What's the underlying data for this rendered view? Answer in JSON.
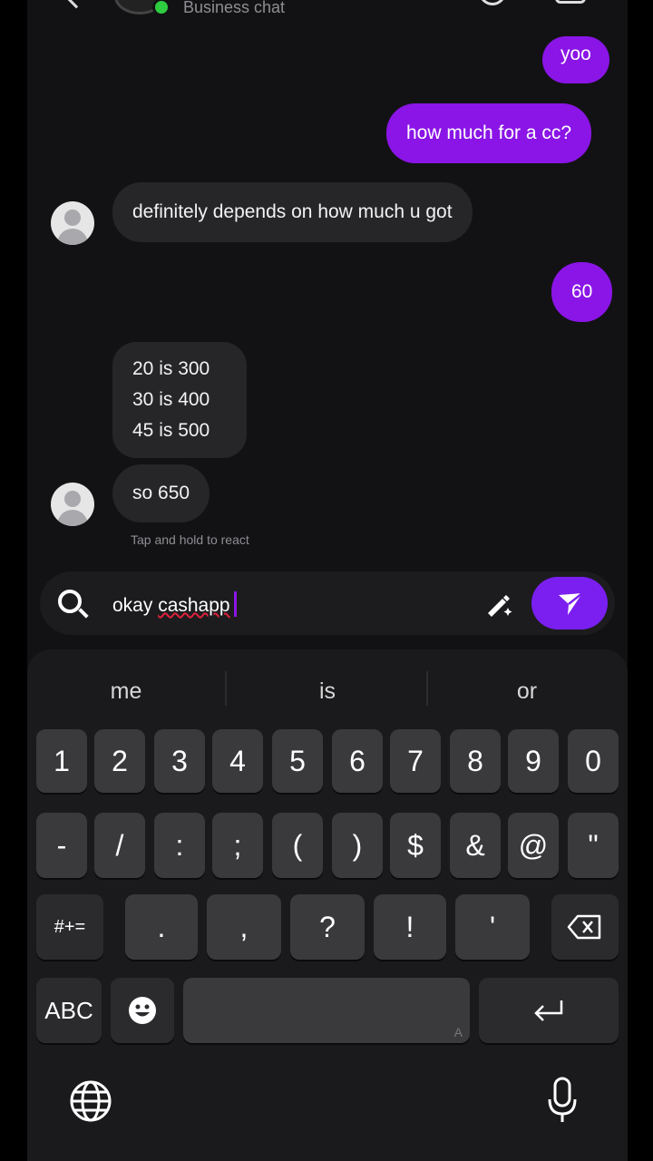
{
  "header": {
    "subtitle": "Business chat"
  },
  "messages": {
    "m1": "yoo",
    "m2": "how much for a cc?",
    "m3": "definitely depends on how much u got",
    "m4": "60",
    "m5": "20 is 300\n30 is 400\n45 is 500",
    "m6": "so 650"
  },
  "hint": "Tap and hold to react",
  "composer": {
    "text_plain": "okay ",
    "text_misspelled": "cashapp"
  },
  "suggestions": [
    "me",
    "is",
    "or"
  ],
  "keys": {
    "row1": [
      "1",
      "2",
      "3",
      "4",
      "5",
      "6",
      "7",
      "8",
      "9",
      "0"
    ],
    "row2": [
      "-",
      "/",
      ":",
      ";",
      "(",
      ")",
      "$",
      "&",
      "@",
      "\""
    ],
    "row3": [
      ".",
      ",",
      "?",
      "!",
      "'"
    ],
    "symbols_label": "#+=",
    "abc_label": "ABC",
    "space_hint": "A"
  },
  "colors": {
    "accent": "#8a15e6",
    "online": "#2ecc40",
    "background": "#121214"
  },
  "icons": [
    "back-icon",
    "call-icon",
    "video-icon",
    "search-icon",
    "magic-pen-icon",
    "send-icon",
    "backspace-icon",
    "emoji-icon",
    "return-icon",
    "globe-icon",
    "microphone-icon"
  ]
}
